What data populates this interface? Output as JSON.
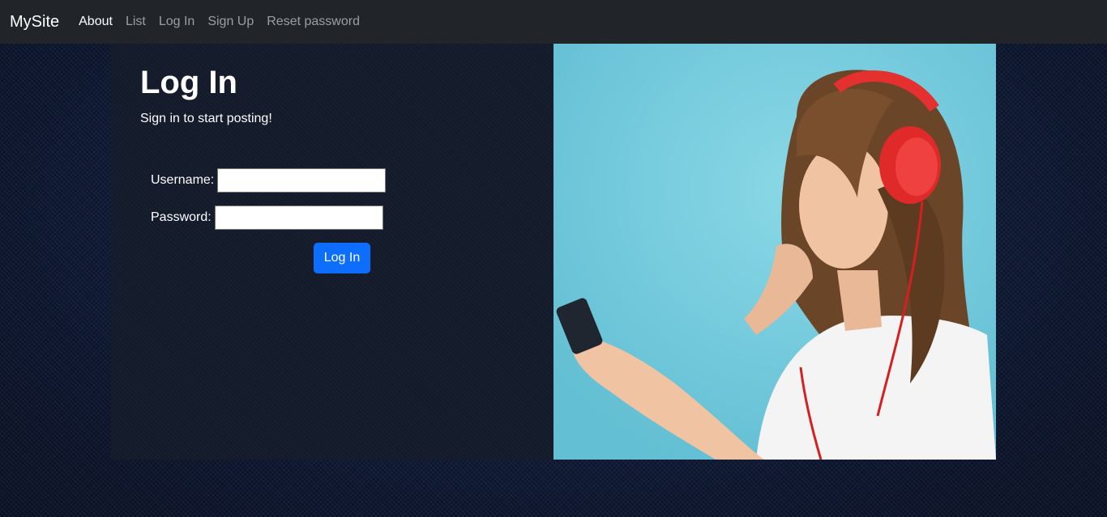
{
  "navbar": {
    "brand": "MySite",
    "links": [
      {
        "label": "About"
      },
      {
        "label": "List"
      },
      {
        "label": "Log In"
      },
      {
        "label": "Sign Up"
      },
      {
        "label": "Reset password"
      }
    ]
  },
  "login": {
    "title": "Log In",
    "subtitle": "Sign in to start posting!",
    "username_label": "Username:",
    "username_value": "",
    "password_label": "Password:",
    "password_value": "",
    "submit_label": "Log In"
  },
  "colors": {
    "navbar": "#212529",
    "primary_button": "#0d6efd",
    "panel": "#131a2a",
    "hero_background": "#6fc8d8"
  }
}
